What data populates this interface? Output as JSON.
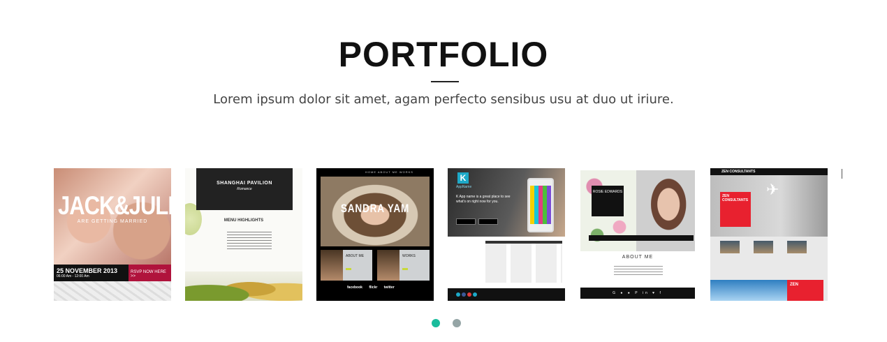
{
  "section": {
    "title": "PORTFOLIO",
    "subtitle": "Lorem ipsum dolor sit amet, agam perfecto sensibus usu at duo ut iriure."
  },
  "items": [
    {
      "kind": "wedding",
      "headline": "JACK&JULIE",
      "tagline": "ARE GETTING MARRIED",
      "date": "25 NOVEMBER 2013",
      "time": "06:00 Am - 12:00 Am",
      "cta": "RSVP NOW HERE >>"
    },
    {
      "kind": "restaurant",
      "headline": "SHANGHAI PAVILION",
      "tagline": "Romance",
      "section_label": "MENU HIGHLIGHTS"
    },
    {
      "kind": "personal",
      "nav": "HOME  ABOUT ME  WORKS",
      "headline": "SANDRA YAM",
      "about_label": "ABOUT ME",
      "works_label": "WORKS",
      "social": "facebook flickr twitter"
    },
    {
      "kind": "app",
      "logo_letter": "K",
      "app_name": "AppName",
      "tagline": "K App name is a great place to see what's on right now for you."
    },
    {
      "kind": "about",
      "card_name": "ROSIE EDWARDS",
      "section_label": "ABOUT ME"
    },
    {
      "kind": "consulting",
      "brand": "ZEN CONSULTANTS",
      "hero_label": "ZEN CONSULTANTS",
      "footer_label": "ZEN"
    }
  ],
  "pagination": {
    "active_color": "#1abc9c",
    "inactive_color": "#95a5a6",
    "pages": [
      {
        "active": true
      },
      {
        "active": false
      }
    ]
  }
}
